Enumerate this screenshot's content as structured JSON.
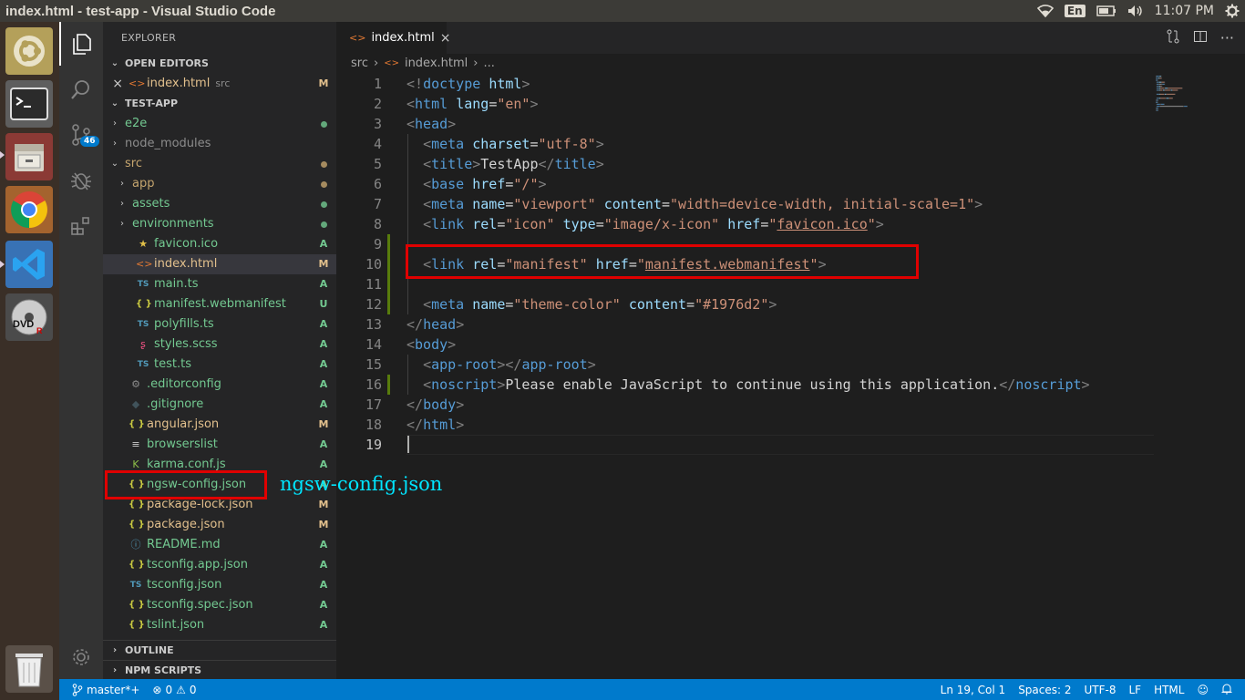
{
  "window": {
    "title": "index.html - test-app - Visual Studio Code"
  },
  "tray": {
    "lang": "En",
    "time": "11:07 PM"
  },
  "activity": {
    "scm_badge": "46"
  },
  "sidebar": {
    "title": "EXPLORER",
    "open_editors_label": "OPEN EDITORS",
    "open_editor": {
      "name": "index.html",
      "dir": "src",
      "status": "M"
    },
    "project_label": "TEST-APP",
    "files": [
      {
        "name": "e2e",
        "kind": "folder",
        "status": "dot",
        "color": "#73c991"
      },
      {
        "name": "node_modules",
        "kind": "folder",
        "status": "",
        "color": "#8c8c8c"
      },
      {
        "name": "src",
        "kind": "folder-open",
        "status": "dot",
        "color": "#c5a56e"
      },
      {
        "name": "app",
        "kind": "folder",
        "status": "dot",
        "color": "#c5a56e"
      },
      {
        "name": "assets",
        "kind": "folder",
        "status": "dot",
        "color": "#73c991"
      },
      {
        "name": "environments",
        "kind": "folder",
        "status": "dot",
        "color": "#73c991"
      },
      {
        "name": "favicon.ico",
        "kind": "star",
        "status": "A",
        "color": "#73c991"
      },
      {
        "name": "index.html",
        "kind": "html",
        "status": "M",
        "color": "#e2c08d"
      },
      {
        "name": "main.ts",
        "kind": "ts",
        "status": "A",
        "color": "#73c991"
      },
      {
        "name": "manifest.webmanifest",
        "kind": "json",
        "status": "U",
        "color": "#73c991"
      },
      {
        "name": "polyfills.ts",
        "kind": "ts",
        "status": "A",
        "color": "#73c991"
      },
      {
        "name": "styles.scss",
        "kind": "scss",
        "status": "A",
        "color": "#73c991"
      },
      {
        "name": "test.ts",
        "kind": "ts",
        "status": "A",
        "color": "#73c991"
      },
      {
        "name": ".editorconfig",
        "kind": "gear",
        "status": "A",
        "color": "#73c991"
      },
      {
        "name": ".gitignore",
        "kind": "git",
        "status": "A",
        "color": "#73c991"
      },
      {
        "name": "angular.json",
        "kind": "json",
        "status": "M",
        "color": "#e2c08d"
      },
      {
        "name": "browserslist",
        "kind": "lines",
        "status": "A",
        "color": "#73c991"
      },
      {
        "name": "karma.conf.js",
        "kind": "karma",
        "status": "A",
        "color": "#73c991"
      },
      {
        "name": "ngsw-config.json",
        "kind": "json",
        "status": "A",
        "color": "#73c991"
      },
      {
        "name": "package-lock.json",
        "kind": "json",
        "status": "M",
        "color": "#e2c08d"
      },
      {
        "name": "package.json",
        "kind": "json",
        "status": "M",
        "color": "#e2c08d"
      },
      {
        "name": "README.md",
        "kind": "info",
        "status": "A",
        "color": "#73c991"
      },
      {
        "name": "tsconfig.app.json",
        "kind": "json",
        "status": "A",
        "color": "#73c991"
      },
      {
        "name": "tsconfig.json",
        "kind": "tsconfig",
        "status": "A",
        "color": "#73c991"
      },
      {
        "name": "tsconfig.spec.json",
        "kind": "json",
        "status": "A",
        "color": "#73c991"
      },
      {
        "name": "tslint.json",
        "kind": "json",
        "status": "A",
        "color": "#73c991"
      }
    ],
    "outline_label": "OUTLINE",
    "npm_label": "NPM SCRIPTS"
  },
  "tab": {
    "name": "index.html",
    "close": "×"
  },
  "breadcrumbs": [
    "src",
    "index.html",
    "..."
  ],
  "code": [
    [
      [
        "g",
        "<!"
      ],
      [
        "t",
        "doctype"
      ],
      [
        "p",
        " "
      ],
      [
        "a",
        "html"
      ],
      [
        "g",
        ">"
      ]
    ],
    [
      [
        "g",
        "<"
      ],
      [
        "t",
        "html"
      ],
      [
        "p",
        " "
      ],
      [
        "a",
        "lang"
      ],
      [
        "p",
        "="
      ],
      [
        "s",
        "\"en\""
      ],
      [
        "g",
        ">"
      ]
    ],
    [
      [
        "g",
        "<"
      ],
      [
        "t",
        "head"
      ],
      [
        "g",
        ">"
      ]
    ],
    [
      [
        "p",
        "  "
      ],
      [
        "g",
        "<"
      ],
      [
        "t",
        "meta"
      ],
      [
        "p",
        " "
      ],
      [
        "a",
        "charset"
      ],
      [
        "p",
        "="
      ],
      [
        "s",
        "\"utf-8\""
      ],
      [
        "g",
        ">"
      ]
    ],
    [
      [
        "p",
        "  "
      ],
      [
        "g",
        "<"
      ],
      [
        "t",
        "title"
      ],
      [
        "g",
        ">"
      ],
      [
        "p",
        "TestApp"
      ],
      [
        "g",
        "</"
      ],
      [
        "t",
        "title"
      ],
      [
        "g",
        ">"
      ]
    ],
    [
      [
        "p",
        "  "
      ],
      [
        "g",
        "<"
      ],
      [
        "t",
        "base"
      ],
      [
        "p",
        " "
      ],
      [
        "a",
        "href"
      ],
      [
        "p",
        "="
      ],
      [
        "s",
        "\"/\""
      ],
      [
        "g",
        ">"
      ]
    ],
    [
      [
        "p",
        "  "
      ],
      [
        "g",
        "<"
      ],
      [
        "t",
        "meta"
      ],
      [
        "p",
        " "
      ],
      [
        "a",
        "name"
      ],
      [
        "p",
        "="
      ],
      [
        "s",
        "\"viewport\""
      ],
      [
        "p",
        " "
      ],
      [
        "a",
        "content"
      ],
      [
        "p",
        "="
      ],
      [
        "s",
        "\"width=device-width, initial-scale=1\""
      ],
      [
        "g",
        ">"
      ]
    ],
    [
      [
        "p",
        "  "
      ],
      [
        "g",
        "<"
      ],
      [
        "t",
        "link"
      ],
      [
        "p",
        " "
      ],
      [
        "a",
        "rel"
      ],
      [
        "p",
        "="
      ],
      [
        "s",
        "\"icon\""
      ],
      [
        "p",
        " "
      ],
      [
        "a",
        "type"
      ],
      [
        "p",
        "="
      ],
      [
        "s",
        "\"image/x-icon\""
      ],
      [
        "p",
        " "
      ],
      [
        "a",
        "href"
      ],
      [
        "p",
        "="
      ],
      [
        "s",
        "\""
      ],
      [
        "su",
        "favicon.ico"
      ],
      [
        "s",
        "\""
      ],
      [
        "g",
        ">"
      ]
    ],
    [],
    [
      [
        "p",
        "  "
      ],
      [
        "g",
        "<"
      ],
      [
        "t",
        "link"
      ],
      [
        "p",
        " "
      ],
      [
        "a",
        "rel"
      ],
      [
        "p",
        "="
      ],
      [
        "s",
        "\"manifest\""
      ],
      [
        "p",
        " "
      ],
      [
        "a",
        "href"
      ],
      [
        "p",
        "="
      ],
      [
        "s",
        "\""
      ],
      [
        "su",
        "manifest.webmanifest"
      ],
      [
        "s",
        "\""
      ],
      [
        "g",
        ">"
      ]
    ],
    [],
    [
      [
        "p",
        "  "
      ],
      [
        "g",
        "<"
      ],
      [
        "t",
        "meta"
      ],
      [
        "p",
        " "
      ],
      [
        "a",
        "name"
      ],
      [
        "p",
        "="
      ],
      [
        "s",
        "\"theme-color\""
      ],
      [
        "p",
        " "
      ],
      [
        "a",
        "content"
      ],
      [
        "p",
        "="
      ],
      [
        "s",
        "\"#1976d2\""
      ],
      [
        "g",
        ">"
      ]
    ],
    [
      [
        "g",
        "</"
      ],
      [
        "t",
        "head"
      ],
      [
        "g",
        ">"
      ]
    ],
    [
      [
        "g",
        "<"
      ],
      [
        "t",
        "body"
      ],
      [
        "g",
        ">"
      ]
    ],
    [
      [
        "p",
        "  "
      ],
      [
        "g",
        "<"
      ],
      [
        "t",
        "app-root"
      ],
      [
        "g",
        "></"
      ],
      [
        "t",
        "app-root"
      ],
      [
        "g",
        ">"
      ]
    ],
    [
      [
        "p",
        "  "
      ],
      [
        "g",
        "<"
      ],
      [
        "t",
        "noscript"
      ],
      [
        "g",
        ">"
      ],
      [
        "p",
        "Please enable JavaScript to continue using this application."
      ],
      [
        "g",
        "</"
      ],
      [
        "t",
        "noscript"
      ],
      [
        "g",
        ">"
      ]
    ],
    [
      [
        "g",
        "</"
      ],
      [
        "t",
        "body"
      ],
      [
        "g",
        ">"
      ]
    ],
    [
      [
        "g",
        "</"
      ],
      [
        "t",
        "html"
      ],
      [
        "g",
        ">"
      ]
    ],
    []
  ],
  "annotation": "ngsw-config.json",
  "status": {
    "branch": "master*+",
    "errors": "0",
    "warnings": "0",
    "position": "Ln 19, Col 1",
    "spaces": "Spaces: 2",
    "encoding": "UTF-8",
    "eol": "LF",
    "language": "HTML"
  }
}
